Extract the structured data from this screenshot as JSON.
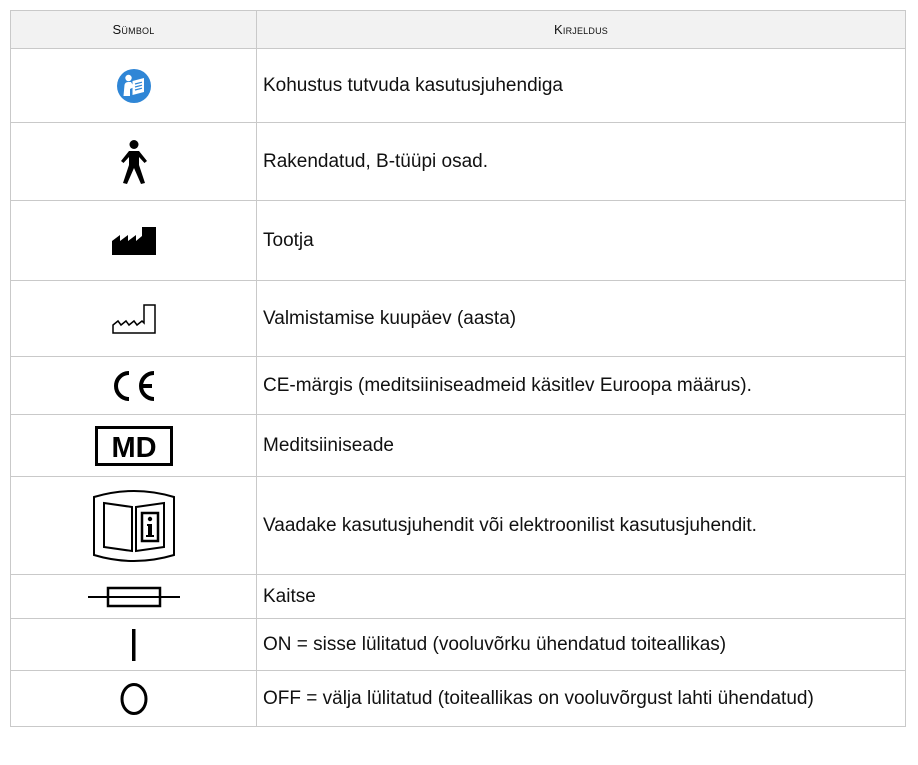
{
  "table": {
    "headers": {
      "symbol": "Sümbol",
      "description": "Kirjeldus"
    },
    "rows": [
      {
        "icon": "read-manual-mandatory-icon",
        "description": "Kohustus tutvuda kasutusjuhendiga"
      },
      {
        "icon": "type-b-applied-part-icon",
        "description": "Rakendatud, B-tüüpi osad."
      },
      {
        "icon": "manufacturer-icon",
        "description": "Tootja"
      },
      {
        "icon": "date-of-manufacture-icon",
        "description": "Valmistamise kuupäev (aasta)"
      },
      {
        "icon": "ce-mark-icon",
        "glyph": "CE",
        "description": "CE-märgis (meditsiiniseadmeid käsitlev Euroopa määrus)."
      },
      {
        "icon": "medical-device-icon",
        "glyph": "MD",
        "description": "Meditsiiniseade"
      },
      {
        "icon": "electronic-ifu-icon",
        "description": "Vaadake kasutusjuhendit või elektroonilist kasutusjuhendit."
      },
      {
        "icon": "fuse-icon",
        "description": "Kaitse"
      },
      {
        "icon": "power-on-icon",
        "description": "ON = sisse lülitatud (vooluvõrku ühendatud toiteallikas)"
      },
      {
        "icon": "power-off-icon",
        "description": "OFF = välja lülitatud (toiteallikas on vooluvõrgust lahti ühendatud)"
      }
    ]
  }
}
